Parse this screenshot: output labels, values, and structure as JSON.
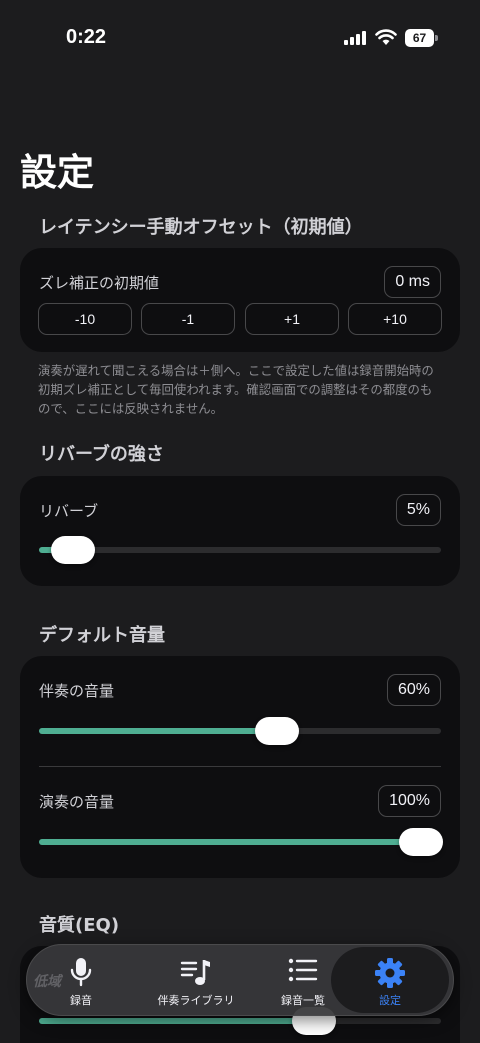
{
  "status_bar": {
    "time": "0:22",
    "battery": "67"
  },
  "page": {
    "title": "設定"
  },
  "latency": {
    "section_title": "レイテンシー手動オフセット（初期値）",
    "label": "ズレ補正の初期値",
    "value": "0 ms",
    "buttons": [
      "-10",
      "-1",
      "+1",
      "+10"
    ],
    "help": "演奏が遅れて聞こえる場合は＋側へ。ここで設定した値は録音開始時の初期ズレ補正として毎回使われます。確認画面での調整はその都度のもので、ここには反映されません。"
  },
  "reverb": {
    "section_title": "リバーブの強さ",
    "label": "リバーブ",
    "value": "5%",
    "level": 0.05
  },
  "volume": {
    "section_title": "デフォルト音量",
    "accompaniment_label": "伴奏の音量",
    "accompaniment_value": "60%",
    "accompaniment_level": 0.6,
    "performance_label": "演奏の音量",
    "performance_value": "100%",
    "performance_level": 1.0
  },
  "eq": {
    "section_title": "音質(EQ)",
    "level": 0.7
  },
  "tab_bar": {
    "watermark": "低域",
    "tabs": [
      {
        "label": "録音",
        "icon": "microphone-icon"
      },
      {
        "label": "伴奏ライブラリ",
        "icon": "music-library-icon"
      },
      {
        "label": "録音一覧",
        "icon": "list-icon"
      },
      {
        "label": "設定",
        "icon": "gear-icon",
        "active": true
      }
    ]
  },
  "colors": {
    "accent": "#4fae92",
    "active_tab": "#3b82f6",
    "background": "#1c1c1e",
    "card": "#0e0e10"
  }
}
